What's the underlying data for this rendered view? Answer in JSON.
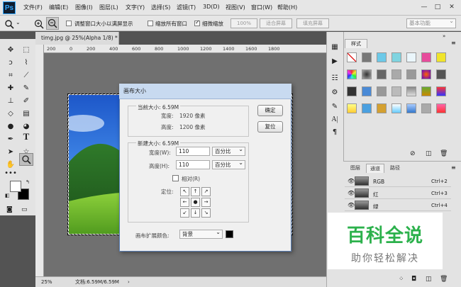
{
  "app": {
    "logo": "Ps"
  },
  "menu": [
    "文件(F)",
    "编辑(E)",
    "图像(I)",
    "图层(L)",
    "文字(Y)",
    "选择(S)",
    "滤镜(T)",
    "3D(D)",
    "视图(V)",
    "窗口(W)",
    "帮助(H)"
  ],
  "window_controls": {
    "minimize": "—",
    "maximize": "□",
    "close": "✕"
  },
  "options_bar": {
    "resize_windows": "调整窗口大小以满屏显示",
    "zoom_all": "缩放所有窗口",
    "scrubby_zoom": "细微缩放",
    "zoom_pct": "100%",
    "fit_screen": "适合屏幕",
    "fill_screen": "填充屏幕",
    "workspace": "基本功能"
  },
  "document": {
    "tab_label": "timg.jpg @ 25%(Alpha 1/8) *",
    "tab_close": "×",
    "ruler_ticks": [
      "200",
      "0",
      "200",
      "400",
      "600",
      "800",
      "1000",
      "1200",
      "1400",
      "1600",
      "1800"
    ]
  },
  "status": {
    "zoom": "25%",
    "doc_size": "文档:6.59M/6.59M"
  },
  "styles_panel": {
    "tab": "样式",
    "menu_icon": "≡"
  },
  "channels_panel": {
    "tabs": [
      "图层",
      "通道",
      "路径"
    ],
    "channels": [
      {
        "name": "RGB",
        "key": "Ctrl+2"
      },
      {
        "name": "红",
        "key": "Ctrl+3"
      },
      {
        "name": "绿",
        "key": "Ctrl+4"
      }
    ]
  },
  "dialog": {
    "title": "画布大小",
    "current_size": "当前大小: 6.59M",
    "width_label": "宽度:",
    "current_width": "1920 像素",
    "height_label": "高度:",
    "current_height": "1200 像素",
    "new_size": "新建大小: 6.59M",
    "new_width_label": "宽度(W):",
    "new_width_value": "110",
    "new_height_label": "高度(H):",
    "new_height_value": "110",
    "unit": "百分比",
    "relative": "相对(R)",
    "anchor_label": "定位:",
    "anchor_arrows": [
      "↖",
      "↑",
      "↗",
      "←",
      "●",
      "→",
      "↙",
      "↓",
      "↘"
    ],
    "ext_color_label": "画布扩展颜色:",
    "ext_color_value": "背景",
    "ok": "确定",
    "reset": "复位"
  },
  "watermark": {
    "title": "百科全说",
    "subtitle": "助你轻松解决"
  },
  "colors": {
    "foreground": "#ffffff",
    "background": "#000000",
    "accent": "#31a8ff",
    "watermark": "#2cb14c"
  }
}
